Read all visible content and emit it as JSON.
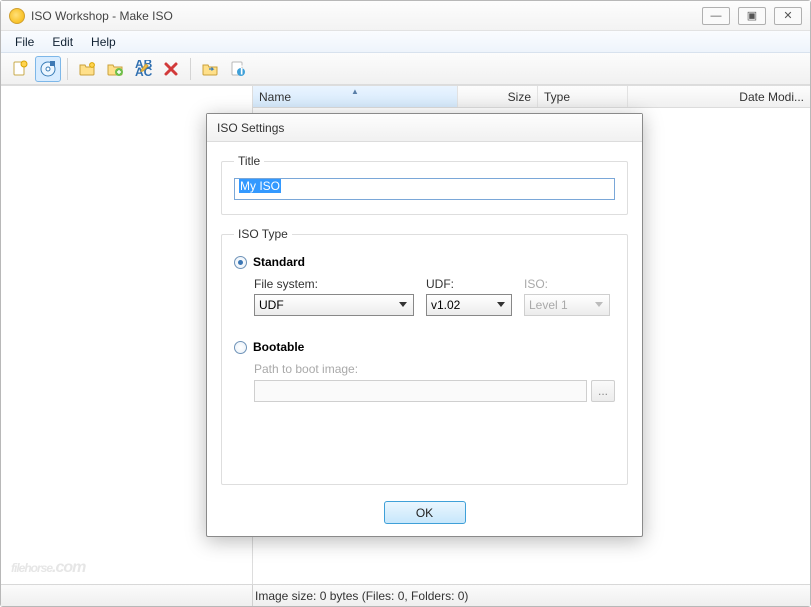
{
  "window": {
    "title": "ISO Workshop - Make ISO",
    "controls": {
      "minimize": "—",
      "maximize": "▣",
      "close": "✕"
    }
  },
  "menubar": {
    "items": [
      "File",
      "Edit",
      "Help"
    ]
  },
  "toolbar": {
    "icons": [
      "new-iso",
      "save-iso",
      "open-folder",
      "add-folder",
      "rename",
      "delete",
      "open-path",
      "properties"
    ]
  },
  "columns": {
    "name": "Name",
    "size": "Size",
    "type": "Type",
    "date": "Date Modi..."
  },
  "statusbar": {
    "text": "Image size: 0 bytes (Files: 0, Folders: 0)"
  },
  "watermark": {
    "brand": "filehorse",
    "suffix": ".com"
  },
  "dialog": {
    "title": "ISO Settings",
    "title_group": "Title",
    "title_value": "My ISO",
    "type_group": "ISO Type",
    "standard_label": "Standard",
    "fs_label": "File system:",
    "fs_value": "UDF",
    "udf_label": "UDF:",
    "udf_value": "v1.02",
    "iso_label": "ISO:",
    "iso_value": "Level 1",
    "bootable_label": "Bootable",
    "path_label": "Path to boot image:",
    "browse_label": "...",
    "ok_label": "OK",
    "selected_radio": "standard"
  }
}
